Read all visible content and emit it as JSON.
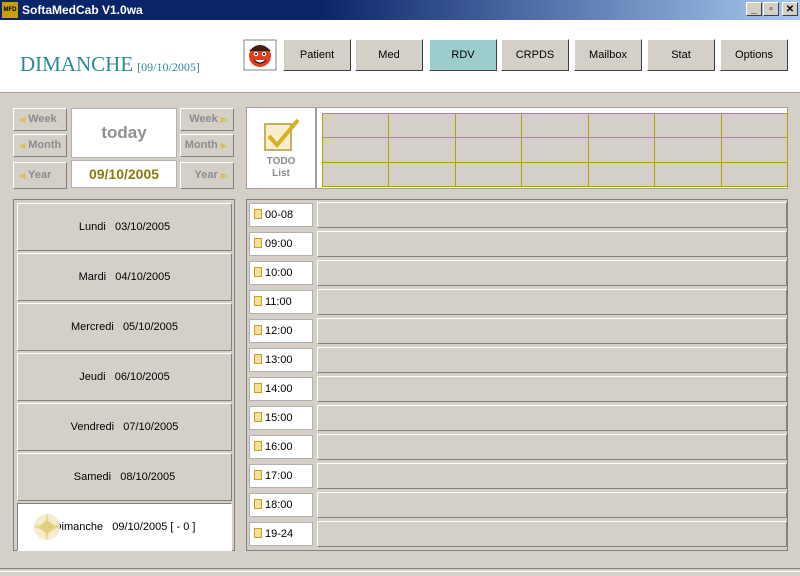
{
  "window": {
    "title": "SoftaMedCab V1.0wa",
    "app_icon_text": "MFD",
    "minimize": "_",
    "restore": "▫",
    "close": "✕"
  },
  "header": {
    "day_name": "DIMANCHE",
    "day_date": "[09/10/2005]"
  },
  "nav": [
    {
      "label": "Patient",
      "active": false
    },
    {
      "label": "Med",
      "active": false
    },
    {
      "label": "RDV",
      "active": true
    },
    {
      "label": "CRPDS",
      "active": false
    },
    {
      "label": "Mailbox",
      "active": false
    },
    {
      "label": "Stat",
      "active": false
    },
    {
      "label": "Options",
      "active": false
    }
  ],
  "calendar_nav": {
    "prev_week": "Week",
    "prev_month": "Month",
    "prev_year": "Year",
    "next_week": "Week",
    "next_month": "Month",
    "next_year": "Year",
    "today": "today",
    "current_date": "09/10/2005"
  },
  "todo": {
    "line1": "TODO",
    "line2": "List"
  },
  "days": [
    {
      "label": "Lundi   03/10/2005"
    },
    {
      "label": "Mardi   04/10/2005"
    },
    {
      "label": "Mercredi   05/10/2005"
    },
    {
      "label": "Jeudi   06/10/2005"
    },
    {
      "label": "Vendredi   07/10/2005"
    },
    {
      "label": "Samedi   08/10/2005"
    },
    {
      "label": "Dimanche   09/10/2005 [ - 0 ]"
    }
  ],
  "hours": [
    "00-08",
    "09:00",
    "10:00",
    "11:00",
    "12:00",
    "13:00",
    "14:00",
    "15:00",
    "16:00",
    "17:00",
    "18:00",
    "19-24"
  ],
  "colors": {
    "accent": "#2c8a96",
    "active_tab": "#9ccccc",
    "date_text": "#8a7c10",
    "grid_line": "#b0a000"
  }
}
